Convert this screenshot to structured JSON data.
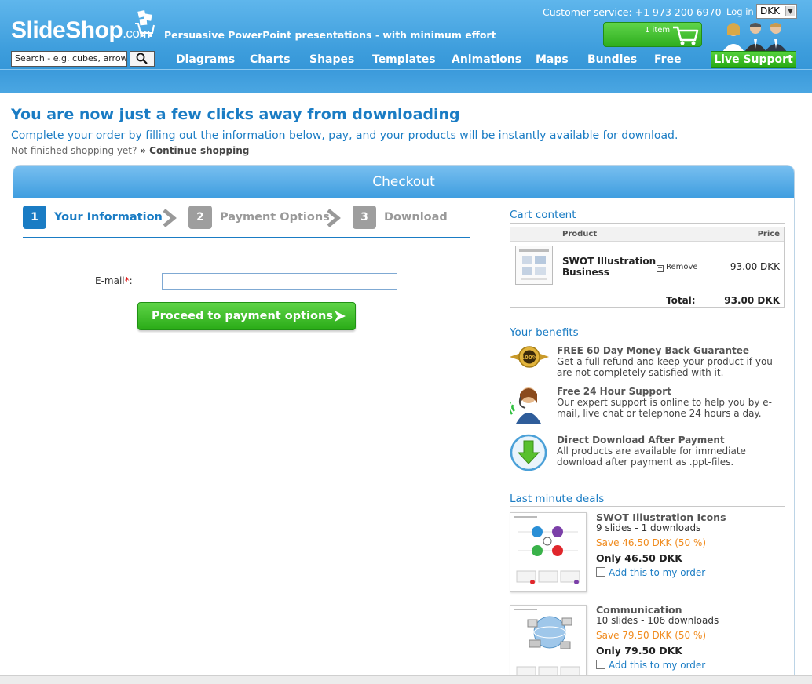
{
  "header": {
    "logo_main": "SlideShop",
    "logo_suffix": ".com",
    "tagline": "Persuasive PowerPoint presentations - with minimum effort",
    "customer_service": "Customer service: +1 973 200 6970",
    "login": "Log in",
    "currency": "DKK",
    "cart_count": "1 item",
    "search_placeholder": "Search - e.g. cubes, arrows...",
    "nav": [
      "Diagrams",
      "Charts",
      "Shapes",
      "Templates",
      "Animations",
      "Maps",
      "Bundles",
      "Free"
    ],
    "live_support": "Live Support"
  },
  "intro": {
    "title": "You are now just a few clicks away from downloading",
    "subtitle": "Complete your order by filling out the information below, pay, and your products will be instantly available for download.",
    "not_finished": "Not finished shopping yet?",
    "continue": "» Continue shopping"
  },
  "checkout": {
    "title": "Checkout",
    "steps": [
      {
        "num": "1",
        "label": "Your Information"
      },
      {
        "num": "2",
        "label": "Payment Options"
      },
      {
        "num": "3",
        "label": "Download"
      }
    ],
    "email_label": "E-mail",
    "required_mark": "*",
    "colon": ":",
    "email_value": "",
    "proceed": "Proceed to payment options"
  },
  "cart": {
    "title": "Cart content",
    "col_product": "Product",
    "col_price": "Price",
    "item_name_1": "SWOT Illustration",
    "item_name_2": "Business",
    "remove": "Remove",
    "item_price": "93.00 DKK",
    "total_label": "Total:",
    "total_value": "93.00 DKK"
  },
  "benefits": {
    "title": "Your benefits",
    "items": [
      {
        "title": "FREE 60 Day Money Back Guarantee",
        "desc": "Get a full refund and keep your product if you are not completely satisfied with it."
      },
      {
        "title": "Free 24 Hour Support",
        "desc": "Our expert support is online to help you by e-mail, live chat or telephone 24 hours a day."
      },
      {
        "title": "Direct Download After Payment",
        "desc": "All products are available for immediate download after payment as .ppt-files."
      }
    ]
  },
  "deals": {
    "title": "Last minute deals",
    "items": [
      {
        "name": "SWOT Illustration Icons",
        "info": "9 slides - 1 downloads",
        "save": "Save 46.50 DKK (50 %)",
        "only": "Only 46.50 DKK",
        "add": "Add this to my order"
      },
      {
        "name": "Communication",
        "info": "10 slides - 106 downloads",
        "save": "Save 79.50 DKK (50 %)",
        "only": "Only 79.50 DKK",
        "add": "Add this to my order"
      }
    ]
  },
  "colors": {
    "brand_blue": "#1a7cc4",
    "header_blue": "#3d9ddc",
    "cta_green": "#2aab17",
    "save_orange": "#f08a1c"
  }
}
